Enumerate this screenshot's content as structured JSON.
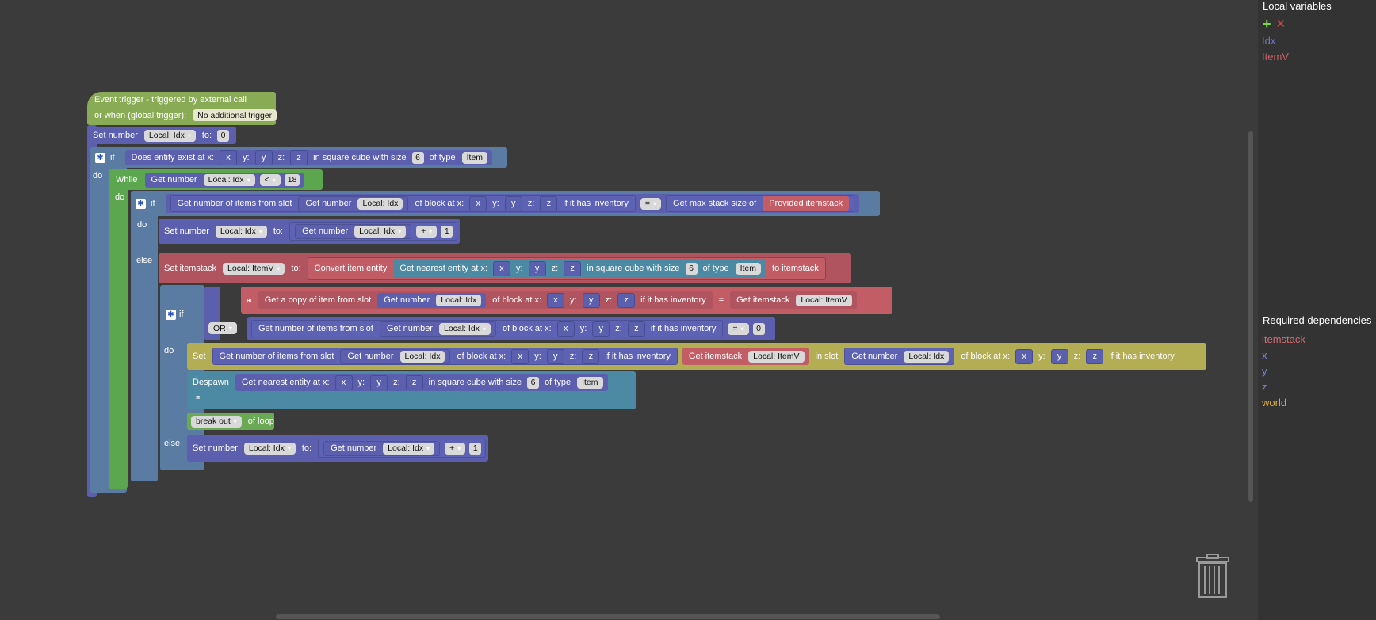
{
  "workspace": {
    "event": {
      "title": "Event trigger - triggered by external call",
      "global_label": "or when (global trigger):",
      "global_value": "No additional trigger"
    },
    "set1": {
      "label": "Set number",
      "var": "Local: Idx",
      "to": "to:",
      "value": "0"
    },
    "if1": {
      "if": "if",
      "do": "do",
      "cond": "Does entity exist at x:",
      "x": "x",
      "y_l": "y:",
      "y": "y",
      "z_l": "z:",
      "z": "z",
      "cube": "in square cube with size",
      "size": "6",
      "of_type": "of type",
      "type": "Item"
    },
    "while": {
      "label": "While",
      "do": "do",
      "get": "Get number",
      "var": "Local: Idx",
      "op": "<",
      "value": "18"
    },
    "if2": {
      "if": "if",
      "do": "do",
      "else": "else",
      "getcount": "Get number of items from slot",
      "getnum": "Get number",
      "var": "Local: Idx",
      "ofblock": "of block at x:",
      "x": "x",
      "y_l": "y:",
      "y": "y",
      "z_l": "z:",
      "z": "z",
      "hasinv": "if it has inventory",
      "op": "=",
      "maxstack": "Get max stack size of",
      "provided": "Provided itemstack"
    },
    "set2": {
      "label": "Set number",
      "var": "Local: Idx",
      "to": "to:",
      "get": "Get number",
      "var2": "Local: Idx",
      "op": "+",
      "value": "1"
    },
    "setitem": {
      "label": "Set itemstack",
      "var": "Local: ItemV",
      "to": "to:",
      "convert": "Convert item entity",
      "nearest": "Get nearest entity at x:",
      "x": "x",
      "y_l": "y:",
      "y": "y",
      "z_l": "z:",
      "z": "z",
      "cube": "in square cube with size",
      "size": "6",
      "of_type": "of type",
      "type": "Item",
      "toitem": "to itemstack"
    },
    "if3": {
      "if": "if",
      "do": "do",
      "else": "else",
      "or": "OR",
      "copy": "Get a copy of item from slot",
      "getnum": "Get number",
      "var": "Local: Idx",
      "ofblock": "of block at x:",
      "x": "x",
      "y_l": "y:",
      "y": "y",
      "z_l": "z:",
      "z": "z",
      "hasinv": "if it has inventory",
      "eq": "=",
      "getitem": "Get itemstack",
      "itemvar": "Local: ItemV",
      "getcount": "Get number of items from slot",
      "op": "=",
      "zero": "0"
    },
    "setslot": {
      "label": "Set",
      "getcount": "Get number of items from slot",
      "getnum": "Get number",
      "var": "Local: Idx",
      "ofblock": "of block at x:",
      "x": "x",
      "y_l": "y:",
      "y": "y",
      "z_l": "z:",
      "z": "z",
      "hasinv": "if it has inventory",
      "getitem": "Get itemstack",
      "itemvar": "Local: ItemV",
      "inslot": "in slot",
      "getnum2": "Get number",
      "var2": "Local: Idx",
      "ofblock2": "of block at x:",
      "x2": "x",
      "z2": "z",
      "hasinv2": "if it has inventory"
    },
    "despawn": {
      "label": "Despawn",
      "nearest": "Get nearest entity at x:",
      "x": "x",
      "y_l": "y:",
      "y": "y",
      "z_l": "z:",
      "z": "z",
      "cube": "in square cube with size",
      "size": "6",
      "of_type": "of type",
      "type": "Item"
    },
    "break": {
      "pill": "break out",
      "label": "of loop"
    },
    "set3": {
      "label": "Set number",
      "var": "Local: Idx",
      "to": "to:",
      "get": "Get number",
      "var2": "Local: Idx",
      "op": "+",
      "value": "1"
    }
  },
  "panel": {
    "local_title": "Local variables",
    "add_icon": "+",
    "remove_icon": "✕",
    "locals": [
      {
        "name": "Idx",
        "color": "#6f74c9"
      },
      {
        "name": "ItemV",
        "color": "#c8606a"
      }
    ],
    "deps_title": "Required dependencies",
    "deps": [
      {
        "name": "itemstack",
        "color": "#d06a73"
      },
      {
        "name": "x",
        "color": "#7c80d6"
      },
      {
        "name": "y",
        "color": "#7c80d6"
      },
      {
        "name": "z",
        "color": "#7c80d6"
      },
      {
        "name": "world",
        "color": "#d4a94f"
      }
    ]
  },
  "colors": {
    "event": "#8aab56",
    "number": "#5b5fae",
    "control": "#5a7ca3",
    "loop": "#5da650",
    "item": "#b0555f",
    "set": "#b3ad54",
    "entity": "#4c8aa3"
  }
}
